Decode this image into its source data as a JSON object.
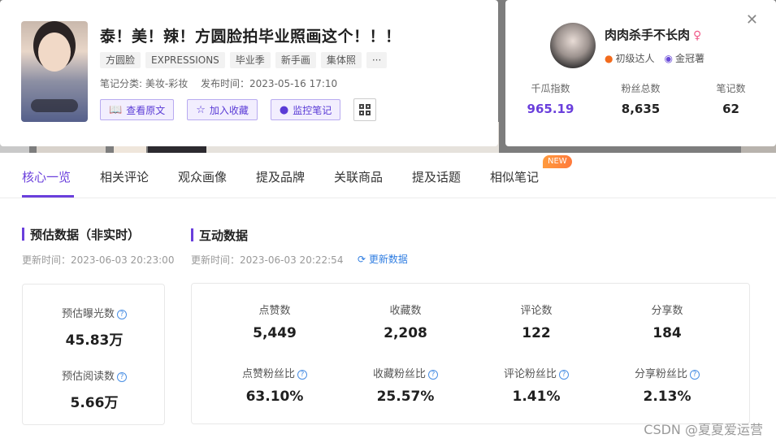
{
  "note": {
    "title": "泰！美！辣！方圆脸拍毕业照画这个！！！",
    "tags": [
      "方圆脸",
      "EXPRESSIONS",
      "毕业季",
      "新手画",
      "集体照",
      "···"
    ],
    "category": "笔记分类: 美妆-彩妆",
    "publish_time": "发布时间：2023-05-16 17:10",
    "actions": {
      "view_original": "查看原文",
      "add_favorite": "加入收藏",
      "monitor_note": "监控笔记"
    }
  },
  "author": {
    "name": "肉肉杀手不长肉",
    "gender_icon": "♀",
    "level": "初级达人",
    "tag": "金冠薯",
    "stats": [
      {
        "label": "千瓜指数",
        "value": "965.19"
      },
      {
        "label": "粉丝总数",
        "value": "8,635"
      },
      {
        "label": "笔记数",
        "value": "62"
      }
    ]
  },
  "tabs": [
    {
      "label": "核心一览",
      "active": true
    },
    {
      "label": "相关评论"
    },
    {
      "label": "观众画像"
    },
    {
      "label": "提及品牌"
    },
    {
      "label": "关联商品"
    },
    {
      "label": "提及话题"
    },
    {
      "label": "相似笔记"
    }
  ],
  "new_badge": "NEW",
  "estimate": {
    "title": "预估数据（非实时）",
    "updated": "更新时间：2023-06-03 20:23:00",
    "metrics": [
      {
        "label": "预估曝光数",
        "value": "45.83万"
      },
      {
        "label": "预估阅读数",
        "value": "5.66万"
      }
    ]
  },
  "interaction": {
    "title": "互动数据",
    "updated": "更新时间：2023-06-03 20:22:54",
    "refresh_label": "更新数据",
    "metrics": [
      {
        "label": "点赞数",
        "value": "5,449"
      },
      {
        "label": "收藏数",
        "value": "2,208"
      },
      {
        "label": "评论数",
        "value": "122"
      },
      {
        "label": "分享数",
        "value": "184"
      },
      {
        "label": "点赞粉丝比",
        "value": "63.10%"
      },
      {
        "label": "收藏粉丝比",
        "value": "25.57%"
      },
      {
        "label": "评论粉丝比",
        "value": "1.41%"
      },
      {
        "label": "分享粉丝比",
        "value": "2.13%"
      }
    ]
  },
  "watermark": "CSDN @夏夏爱运营",
  "colors": {
    "accent": "#6a3fdc",
    "link": "#2f7de1",
    "new_badge": "#ff8a3c"
  }
}
